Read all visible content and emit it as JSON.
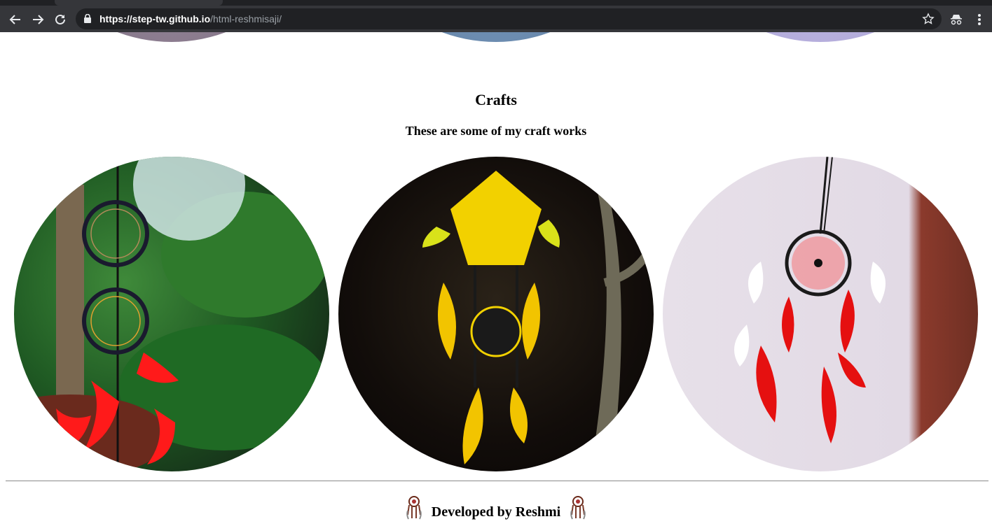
{
  "browser": {
    "url_host": "https://step-tw.github.io",
    "url_path": "/html-reshmisaji/"
  },
  "crafts": {
    "title": "Crafts",
    "subtitle": "These are some of my craft works",
    "images": [
      {
        "name": "dreamcatcher-black-red"
      },
      {
        "name": "dreamcatcher-yellow"
      },
      {
        "name": "dreamcatcher-red-white"
      }
    ]
  },
  "footer": {
    "text": "Developed by Reshmi"
  },
  "colors": {
    "chrome_dark": "#202124",
    "chrome_toolbar": "#35363a",
    "feather_red": "#ff1a1a",
    "feather_yellow": "#f2d100"
  }
}
